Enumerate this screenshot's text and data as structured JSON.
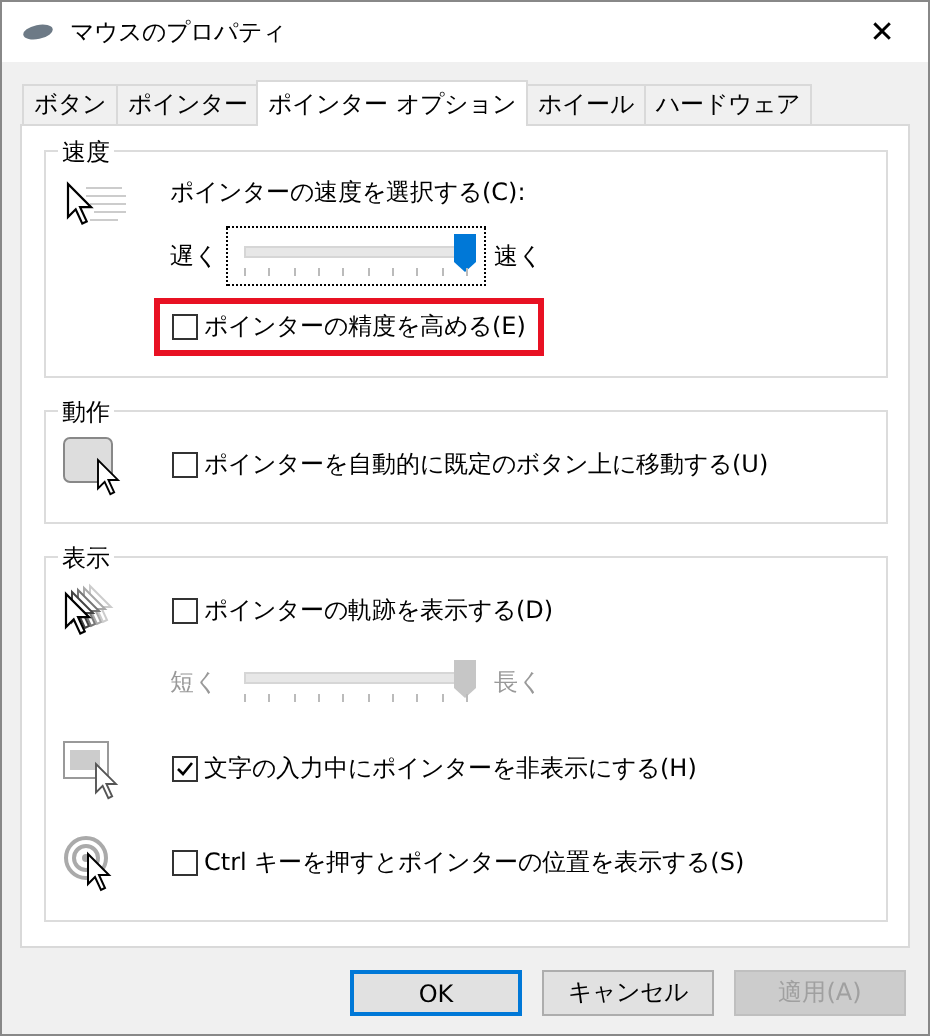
{
  "window": {
    "title": "マウスのプロパティ",
    "close": "✕"
  },
  "tabs": [
    {
      "label": "ボタン",
      "selected": false
    },
    {
      "label": "ポインター",
      "selected": false
    },
    {
      "label": "ポインター オプション",
      "selected": true
    },
    {
      "label": "ホイール",
      "selected": false
    },
    {
      "label": "ハードウェア",
      "selected": false
    }
  ],
  "groups": [
    {
      "legend": "速度",
      "sections": [
        {
          "rows": [
            {
              "kind": "label",
              "text": "ポインターの速度を選択する(C):"
            },
            {
              "kind": "slider",
              "min_label": "遅く",
              "max_label": "速く",
              "level": 1,
              "disabled": false,
              "focused": true
            },
            {
              "kind": "checkbox",
              "label": "ポインターの精度を高める(E)",
              "checked": false,
              "highlighted": true
            }
          ]
        }
      ]
    },
    {
      "legend": "動作",
      "sections": [
        {
          "rows": [
            {
              "kind": "checkbox",
              "label": "ポインターを自動的に既定のボタン上に移動する(U)",
              "checked": false,
              "highlighted": false
            }
          ]
        }
      ]
    },
    {
      "legend": "表示",
      "sections": [
        {
          "rows": [
            {
              "kind": "checkbox",
              "label": "ポインターの軌跡を表示する(D)",
              "checked": false,
              "highlighted": false
            },
            {
              "kind": "slider",
              "min_label": "短く",
              "max_label": "長く",
              "level": 1,
              "disabled": true,
              "focused": false
            }
          ]
        },
        {
          "rows": [
            {
              "kind": "checkbox",
              "label": "文字の入力中にポインターを非表示にする(H)",
              "checked": true,
              "highlighted": false
            }
          ]
        },
        {
          "rows": [
            {
              "kind": "checkbox",
              "label": "Ctrl キーを押すとポインターの位置を表示する(S)",
              "checked": false,
              "highlighted": false
            }
          ]
        }
      ]
    }
  ],
  "buttons": [
    {
      "label": "OK",
      "default": true,
      "disabled": false
    },
    {
      "label": "キャンセル",
      "default": false,
      "disabled": false
    },
    {
      "label": "適用(A)",
      "default": false,
      "disabled": true
    }
  ]
}
